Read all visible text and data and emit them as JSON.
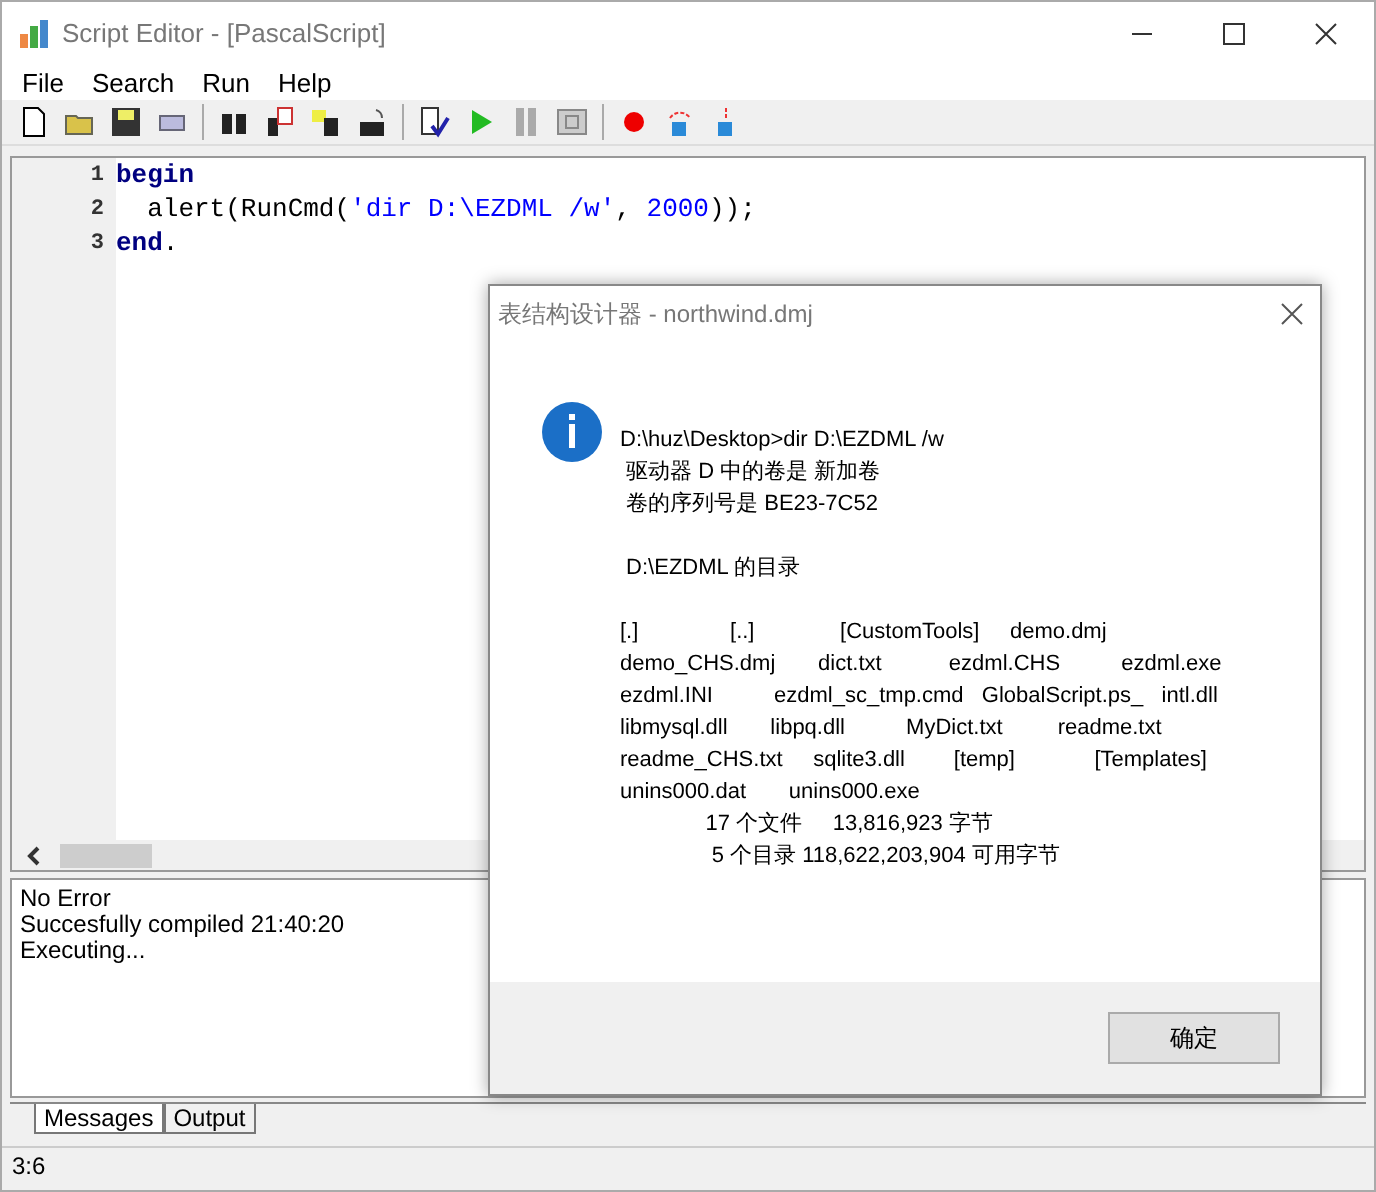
{
  "window": {
    "title": "Script Editor - [PascalScript]"
  },
  "menu": [
    "File",
    "Search",
    "Run",
    "Help"
  ],
  "editor": {
    "lines": [
      {
        "number": "1",
        "tokens": [
          {
            "kind": "keyword",
            "text": "begin"
          }
        ]
      },
      {
        "number": "2",
        "tokens": [
          {
            "kind": "plain",
            "text": "  alert(RunCmd("
          },
          {
            "kind": "string",
            "text": "'dir D:\\EZDML /w'"
          },
          {
            "kind": "plain",
            "text": ", "
          },
          {
            "kind": "string",
            "text": "2000"
          },
          {
            "kind": "plain",
            "text": "));"
          }
        ]
      },
      {
        "number": "3",
        "tokens": [
          {
            "kind": "keyword",
            "text": "end"
          },
          {
            "kind": "plain",
            "text": "."
          }
        ]
      }
    ]
  },
  "messages": [
    "No Error",
    "Succesfully compiled 21:40:20",
    "Executing..."
  ],
  "bottom_tabs": [
    {
      "label": "Messages",
      "selected": true
    },
    {
      "label": "Output",
      "selected": false
    }
  ],
  "status_bar": "3:6",
  "dialog": {
    "title": "表结构设计器 - northwind.dmj",
    "paragraphs": [
      [
        "D:\\huz\\Desktop>dir D:\\EZDML /w",
        " 驱动器 D 中的卷是 新加卷",
        " 卷的序列号是 BE23-7C52"
      ],
      [
        " D:\\EZDML 的目录"
      ],
      [
        "[.]               [..]              [CustomTools]     demo.dmj",
        "demo_CHS.dmj       dict.txt           ezdml.CHS          ezdml.exe",
        "ezdml.INI          ezdml_sc_tmp.cmd   GlobalScript.ps_   intl.dll",
        "libmysql.dll       libpq.dll          MyDict.txt         readme.txt",
        "readme_CHS.txt     sqlite3.dll        [temp]             [Templates]",
        "unins000.dat       unins000.exe",
        "              17 个文件     13,816,923 字节",
        "               5 个目录 118,622,203,904 可用字节"
      ]
    ],
    "button": "确定"
  }
}
